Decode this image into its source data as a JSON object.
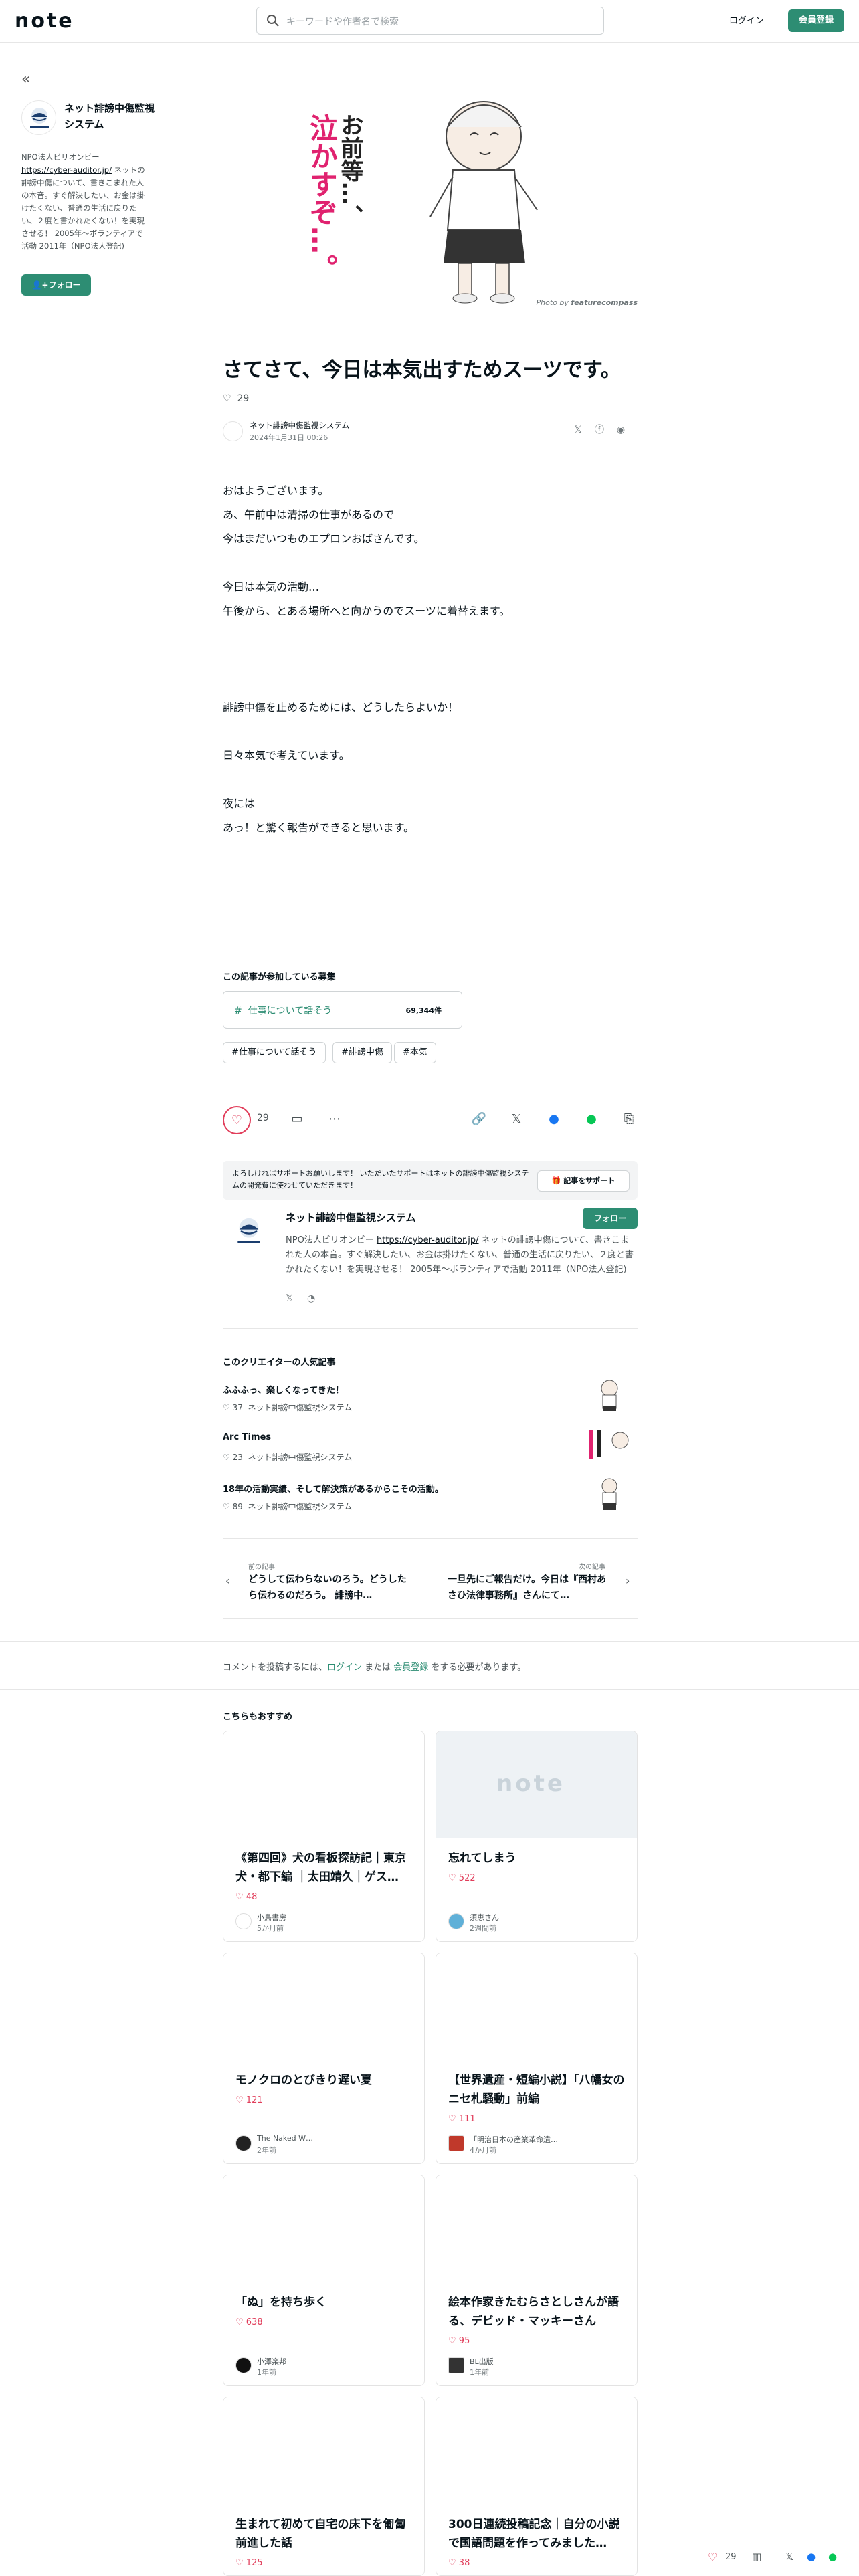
{
  "header": {
    "logo": "note",
    "search_placeholder": "キーワードや作者名で検索",
    "login": "ログイン",
    "register": "会員登録"
  },
  "sidebar": {
    "collapse_icon": "«",
    "name": "ネット誹謗中傷監視システム",
    "bio_prefix": "NPO法人ビリオンビー",
    "bio_link": "https://cyber-auditor.jp/",
    "bio_rest": " ネットの誹謗中傷について、書きこまれた人の本音。すぐ解決したい、お金は掛けたくない、普通の生活に戻りたい、２度と書かれたくない！を実現させる！ 2005年〜ボランティアで活動 2011年（NPO法人登記)",
    "follow": "フォロー"
  },
  "hero": {
    "text1": "お前等…、",
    "text2": "泣かすぞ…。",
    "credit_prefix": "Photo by ",
    "credit_name": "featurecompass"
  },
  "article": {
    "title": "さてさて、今日は本気出すためスーツです。",
    "likes": "29",
    "author": "ネット誹謗中傷監視システム",
    "date": "2024年1月31日 00:26",
    "paragraphs": [
      [
        "おはようございます。",
        "あ、午前中は清掃の仕事があるので",
        "今はまだいつものエプロンおばさんです。"
      ],
      [
        "今日は本気の活動…",
        "午後から、とある場所へと向かうのでスーツに着替えます。"
      ],
      [
        "誹謗中傷を止めるためには、どうしたらよいか！"
      ],
      [
        "日々本気で考えています。"
      ],
      [
        "夜には",
        "あっ！と驚く報告ができると思います。"
      ]
    ]
  },
  "contest": {
    "section_title": "この記事が参加している募集",
    "name": "仕事について話そう",
    "count": "69,344件",
    "tags": [
      "#仕事について話そう",
      "#誹謗中傷",
      "#本気"
    ]
  },
  "actions": {
    "likes": "29"
  },
  "support": {
    "text": "よろしければサポートお願いします！ いただいたサポートはネットの誹謗中傷監視システムの開発費に使わせていただきます！",
    "button": "記事をサポート"
  },
  "creator": {
    "name": "ネット誹謗中傷監視システム",
    "follow": "フォロー",
    "bio_prefix": "NPO法人ビリオンビー ",
    "bio_link": "https://cyber-auditor.jp/",
    "bio_rest": " ネットの誹謗中傷について、書きこまれた人の本音。すぐ解決したい、お金は掛けたくない、普通の生活に戻りたい、２度と書かれたくない！を実現させる！ 2005年〜ボランティアで活動 2011年（NPO法人登記)"
  },
  "popular": {
    "heading": "このクリエイターの人気記事",
    "items": [
      {
        "title": "ふふふっ、楽しくなってきた！",
        "likes": "37",
        "author": "ネット誹謗中傷監視システム"
      },
      {
        "title": "Arc Times",
        "likes": "23",
        "author": "ネット誹謗中傷監視システム"
      },
      {
        "title": "18年の活動実績、そして解決策があるからこその活動。",
        "likes": "89",
        "author": "ネット誹謗中傷監視システム"
      }
    ]
  },
  "prevnext": {
    "prev_label": "前の記事",
    "prev_title": "どうして伝わらないのろう。どうしたら伝わるのだろう。 誹謗中…",
    "next_label": "次の記事",
    "next_title": "一旦先にご報告だけ。今日は『西村あさひ法律事務所』さんにて…"
  },
  "comment": {
    "prefix": "コメントを投稿するには、",
    "login": "ログイン",
    "mid": " または ",
    "register": "会員登録",
    "suffix": " をする必要があります。"
  },
  "recommend": {
    "heading": "こちらもおすすめ",
    "cards": [
      {
        "title": "《第四回》犬の看板探訪記｜東京犬・都下編 ｜太田靖久｜ゲス…",
        "likes": "48",
        "author": "小鳥書房",
        "time": "5か月前"
      },
      {
        "title": "忘れてしまう",
        "likes": "522",
        "author": "須恵さん",
        "time": "2週間前"
      },
      {
        "title": "モノクロのとびきり遅い夏",
        "likes": "121",
        "author": "The Naked W…",
        "time": "2年前"
      },
      {
        "title": "【世界遺産・短編小説】「八幡女のニセ札騒動」前編",
        "likes": "111",
        "author": "「明治日本の産業革命遺…",
        "time": "4か月前"
      },
      {
        "title": "「ぬ」を持ち歩く",
        "likes": "638",
        "author": "小澤楽邦",
        "time": "1年前"
      },
      {
        "title": "絵本作家きたむらさとしさんが語る、デビッド・マッキーさん",
        "likes": "95",
        "author": "BL出版",
        "time": "1年前"
      },
      {
        "title": "生まれて初めて自宅の床下を匍匐前進した話",
        "likes": "125",
        "author": "",
        "time": ""
      },
      {
        "title": "300日連続投稿記念｜自分の小説で国語問題を作ってみました…",
        "likes": "38",
        "author": "",
        "time": ""
      }
    ]
  },
  "floating": {
    "likes": "29"
  },
  "colors": {
    "brand": "#2d8d73",
    "like": "#e13d5a",
    "hero_pink": "#e0226f"
  }
}
